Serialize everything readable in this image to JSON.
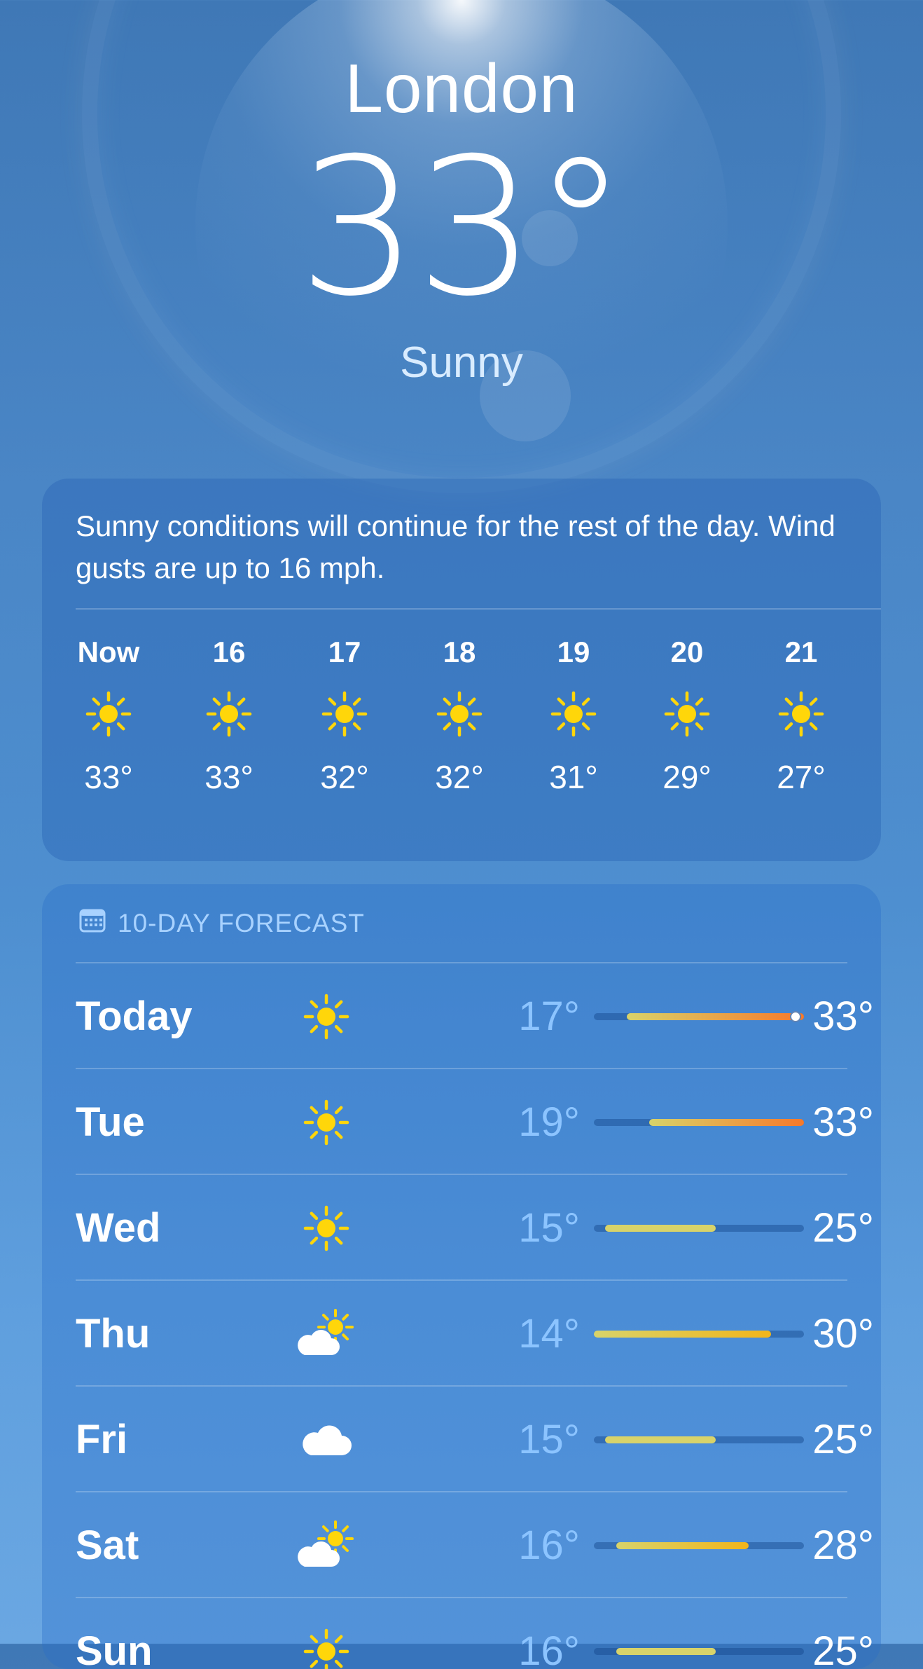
{
  "city": "London",
  "current_temp": "33°",
  "condition": "Sunny",
  "summary": "Sunny conditions will continue for the rest of the day. Wind gusts are up to 16 mph.",
  "hourly": [
    {
      "label": "Now",
      "icon": "sun-icon",
      "temp": "33°"
    },
    {
      "label": "16",
      "icon": "sun-icon",
      "temp": "33°"
    },
    {
      "label": "17",
      "icon": "sun-icon",
      "temp": "32°"
    },
    {
      "label": "18",
      "icon": "sun-icon",
      "temp": "32°"
    },
    {
      "label": "19",
      "icon": "sun-icon",
      "temp": "31°"
    },
    {
      "label": "20",
      "icon": "sun-icon",
      "temp": "29°"
    },
    {
      "label": "21",
      "icon": "sun-icon",
      "temp": "27°"
    }
  ],
  "forecast": {
    "header": "10-DAY FORECAST",
    "range_min": 14,
    "range_max": 33,
    "days": [
      {
        "day": "Today",
        "icon": "sun-icon",
        "low": "17°",
        "high": "33°",
        "low_val": 17,
        "high_val": 33,
        "current_val": 33
      },
      {
        "day": "Tue",
        "icon": "sun-icon",
        "low": "19°",
        "high": "33°",
        "low_val": 19,
        "high_val": 33
      },
      {
        "day": "Wed",
        "icon": "sun-icon",
        "low": "15°",
        "high": "25°",
        "low_val": 15,
        "high_val": 25
      },
      {
        "day": "Thu",
        "icon": "partly-cloudy-icon",
        "low": "14°",
        "high": "30°",
        "low_val": 14,
        "high_val": 30
      },
      {
        "day": "Fri",
        "icon": "cloud-icon",
        "low": "15°",
        "high": "25°",
        "low_val": 15,
        "high_val": 25
      },
      {
        "day": "Sat",
        "icon": "partly-cloudy-icon",
        "low": "16°",
        "high": "28°",
        "low_val": 16,
        "high_val": 28
      },
      {
        "day": "Sun",
        "icon": "sun-icon",
        "low": "16°",
        "high": "25°",
        "low_val": 16,
        "high_val": 25
      }
    ]
  },
  "colors": {
    "sun": "#FFD60A",
    "cool": "#D8D36A",
    "warm": "#F2B51B",
    "hot": "#F7792A"
  }
}
